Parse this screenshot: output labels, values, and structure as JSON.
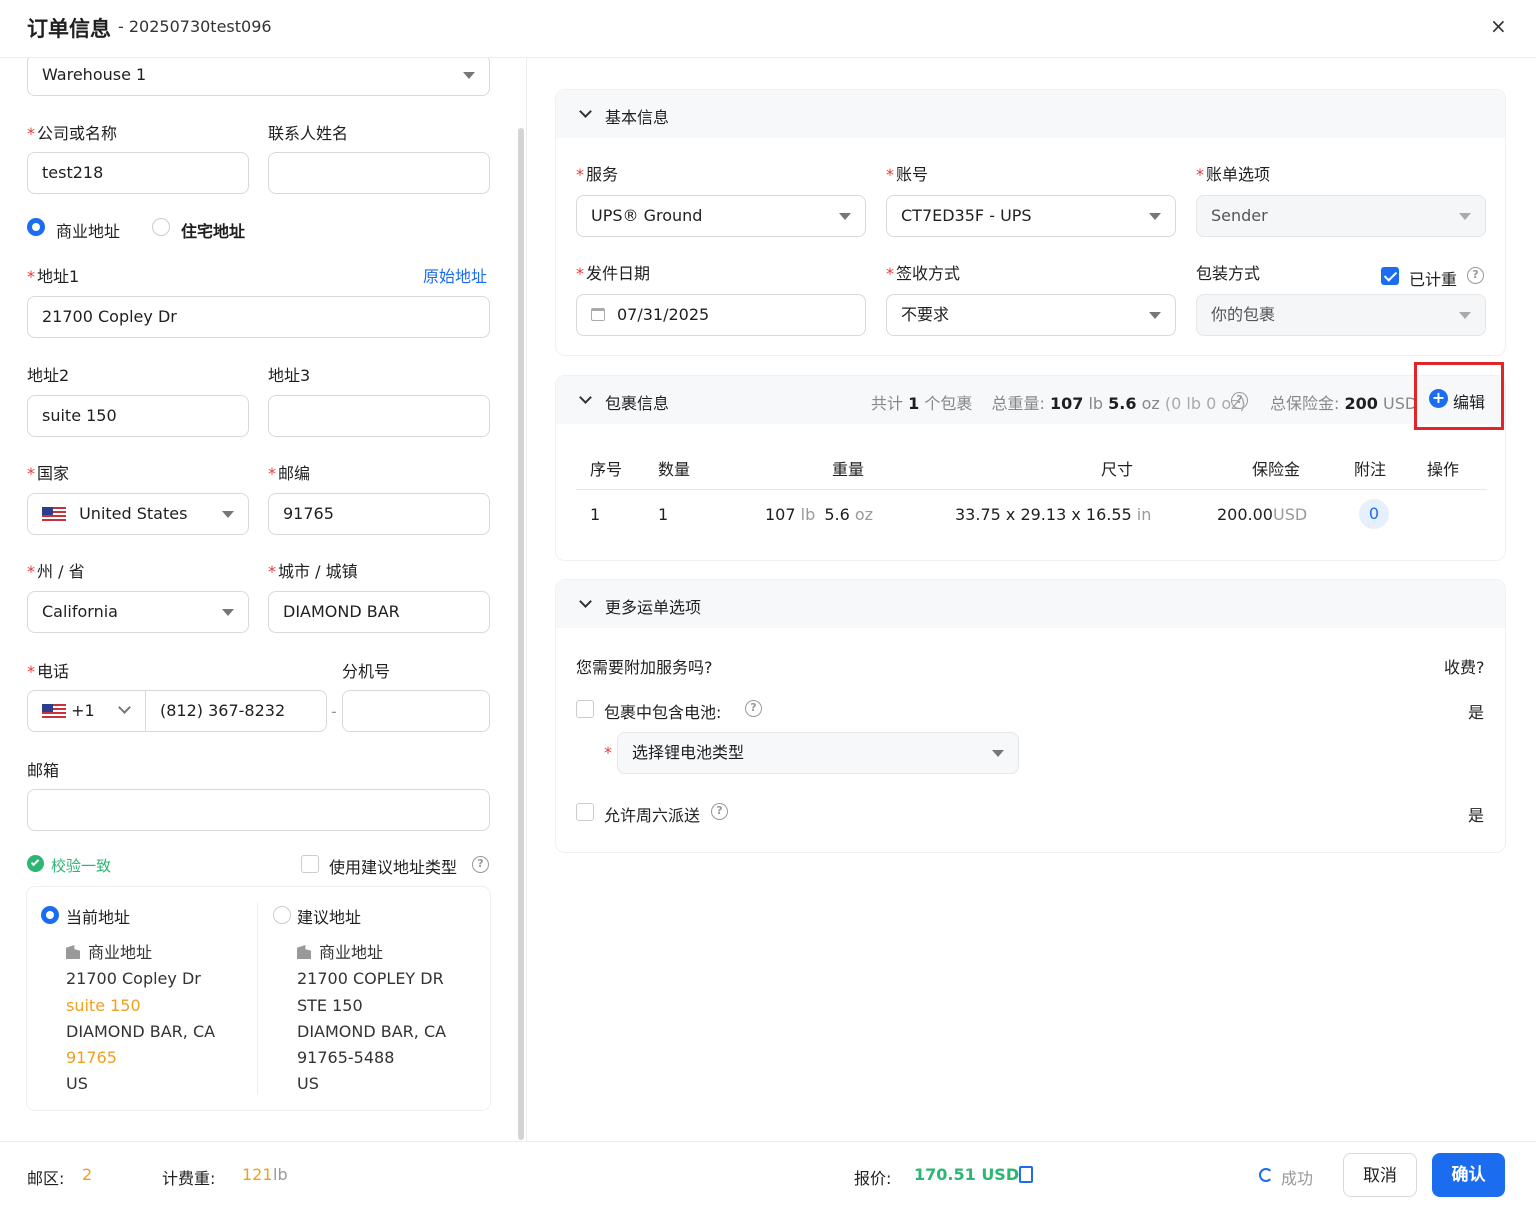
{
  "header": {
    "title": "订单信息",
    "order_id": "- 20250730test096",
    "close": "×"
  },
  "left": {
    "warehouse": "Warehouse 1",
    "company_label": "公司或名称",
    "company_value": "test218",
    "contact_label": "联系人姓名",
    "contact_value": "",
    "addr_type_commercial": "商业地址",
    "addr_type_residential": "住宅地址",
    "addr1_label": "地址1",
    "original_addr_link": "原始地址",
    "addr1_value": "21700 Copley Dr",
    "addr2_label": "地址2",
    "addr2_value": "suite 150",
    "addr3_label": "地址3",
    "addr3_value": "",
    "country_label": "国家",
    "country_value": "United States",
    "zip_label": "邮编",
    "zip_value": "91765",
    "state_label": "州 / 省",
    "state_value": "California",
    "city_label": "城市 / 城镇",
    "city_value": "DIAMOND BAR",
    "phone_label": "电话",
    "phone_code": "+1",
    "phone_value": "(812) 367-8232",
    "ext_label": "分机号",
    "ext_value": "",
    "ext_sep": "-",
    "email_label": "邮箱",
    "email_value": "",
    "verify_text": "校验一致",
    "use_suggest_label": "使用建议地址类型",
    "current": {
      "title": "当前地址",
      "type": "商业地址",
      "line1": "21700 Copley Dr",
      "line2": "suite 150",
      "line3": "DIAMOND BAR, CA",
      "line4": "91765",
      "line5": "US"
    },
    "suggested": {
      "title": "建议地址",
      "type": "商业地址",
      "line1": "21700 COPLEY DR",
      "line2": "STE 150",
      "line3": "DIAMOND BAR, CA",
      "line4": "91765-5488",
      "line5": "US"
    }
  },
  "basic": {
    "title": "基本信息",
    "service_label": "服务",
    "service_value": "UPS® Ground",
    "account_label": "账号",
    "account_value": "CT7ED35F - UPS",
    "bill_label": "账单选项",
    "bill_value": "Sender",
    "date_label": "发件日期",
    "date_value": "07/31/2025",
    "sign_label": "签收方式",
    "sign_value": "不要求",
    "pack_label": "包装方式",
    "pack_value": "你的包裹",
    "weighed_label": "已计重"
  },
  "package": {
    "title": "包裹信息",
    "summary_total_prefix": "共计",
    "summary_count": "1",
    "summary_total_suffix": "个包裹",
    "weight_prefix": "总重量:",
    "weight_lb": "107",
    "weight_lb_unit": "lb",
    "weight_oz": "5.6",
    "weight_oz_unit": "oz",
    "weight_extra": "(0 lb 0 oz)",
    "insurance_prefix": "总保险金:",
    "insurance_value": "200",
    "insurance_unit": "USD",
    "edit_label": "编辑",
    "columns": [
      "序号",
      "数量",
      "重量",
      "尺寸",
      "保险金",
      "附注",
      "操作"
    ],
    "rows": [
      {
        "seq": "1",
        "qty": "1",
        "w_lb": "107",
        "w_lb_unit": "lb",
        "w_oz": "5.6",
        "w_oz_unit": "oz",
        "dims": "33.75 x 29.13 x 16.55",
        "dims_unit": "in",
        "ins": "200.00",
        "ins_unit": "USD",
        "note": "0"
      }
    ]
  },
  "more": {
    "title": "更多运单选项",
    "question": "您需要附加服务吗?",
    "fee_label": "收费?",
    "battery_label": "包裹中包含电池:",
    "battery_fee": "是",
    "battery_placeholder": "选择锂电池类型",
    "saturday_label": "允许周六派送",
    "saturday_fee": "是"
  },
  "footer": {
    "zone_label": "邮区:",
    "zone_value": "2",
    "billed_label": "计费重:",
    "billed_value": "121",
    "billed_unit": "lb",
    "quote_label": "报价:",
    "quote_value": "170.51 USD",
    "status": "成功",
    "cancel": "取消",
    "confirm": "确认"
  },
  "colors": {
    "primary": "#1c6cf0",
    "success": "#2bb673",
    "warning": "#f0a020",
    "required": "#e43b3b",
    "highlight_box": "#e0262b"
  }
}
